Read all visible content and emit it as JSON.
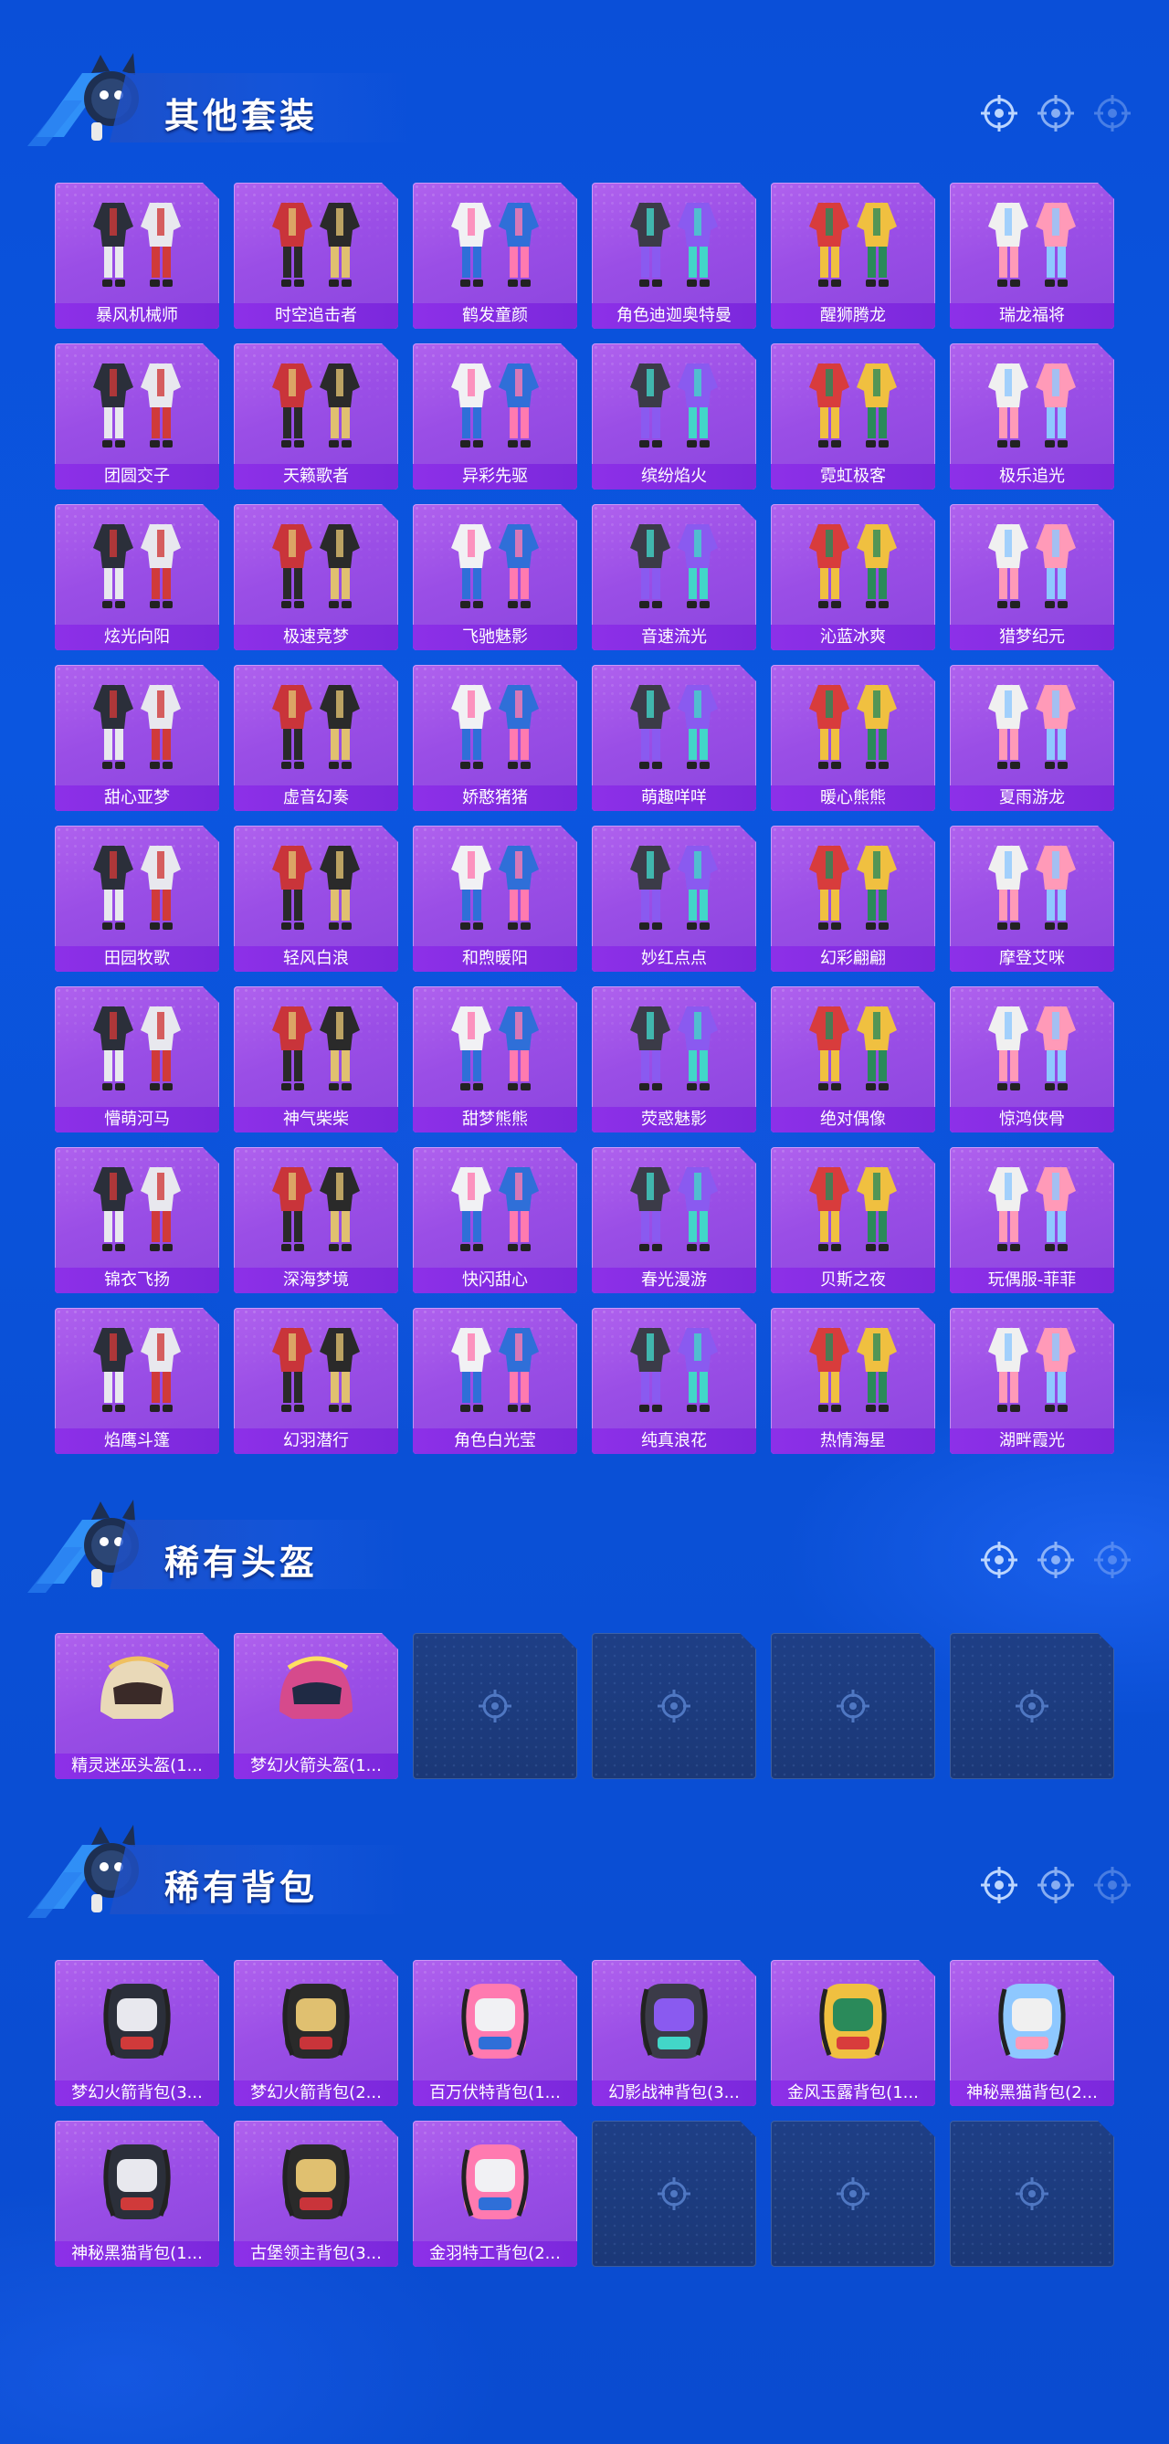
{
  "colors": {
    "background": "#0a4fd8",
    "card_purple": "#9a4ee6",
    "label_purple": "#8d30e8",
    "empty_slot": "#1e3f86"
  },
  "sections": [
    {
      "title": "其他套装",
      "items": [
        "暴风机械师",
        "时空追击者",
        "鹤发童颜",
        "角色迪迦奥特曼",
        "醒狮腾龙",
        "瑞龙福将",
        "团圆交子",
        "天籁歌者",
        "异彩先驱",
        "缤纷焰火",
        "霓虹极客",
        "极乐追光",
        "炫光向阳",
        "极速竞梦",
        "飞驰魅影",
        "音速流光",
        "沁蓝冰爽",
        "猎梦纪元",
        "甜心亚梦",
        "虚音幻奏",
        "娇憨猪猪",
        "萌趣咩咩",
        "暖心熊熊",
        "夏雨游龙",
        "田园牧歌",
        "轻风白浪",
        "和煦暖阳",
        "妙红点点",
        "幻彩翩翩",
        "摩登艾咪",
        "懵萌河马",
        "神气柴柴",
        "甜梦熊熊",
        "荧惑魅影",
        "绝对偶像",
        "惊鸿侠骨",
        "锦衣飞扬",
        "深海梦境",
        "快闪甜心",
        "春光漫游",
        "贝斯之夜",
        "玩偶服-菲菲",
        "焰鹰斗篷",
        "幻羽潜行",
        "角色白光莹",
        "纯真浪花",
        "热情海星",
        "湖畔霞光"
      ],
      "empty_slots": 0
    },
    {
      "title": "稀有头盔",
      "items": [
        "精灵迷巫头盔(1...",
        "梦幻火箭头盔(1..."
      ],
      "empty_slots": 4
    },
    {
      "title": "稀有背包",
      "items": [
        "梦幻火箭背包(3...",
        "梦幻火箭背包(2...",
        "百万伏特背包(1...",
        "幻影战神背包(3...",
        "金风玉露背包(1...",
        "神秘黑猫背包(2...",
        "神秘黑猫背包(1...",
        "古堡领主背包(3...",
        "金羽特工背包(2..."
      ],
      "empty_slots": 3
    }
  ]
}
